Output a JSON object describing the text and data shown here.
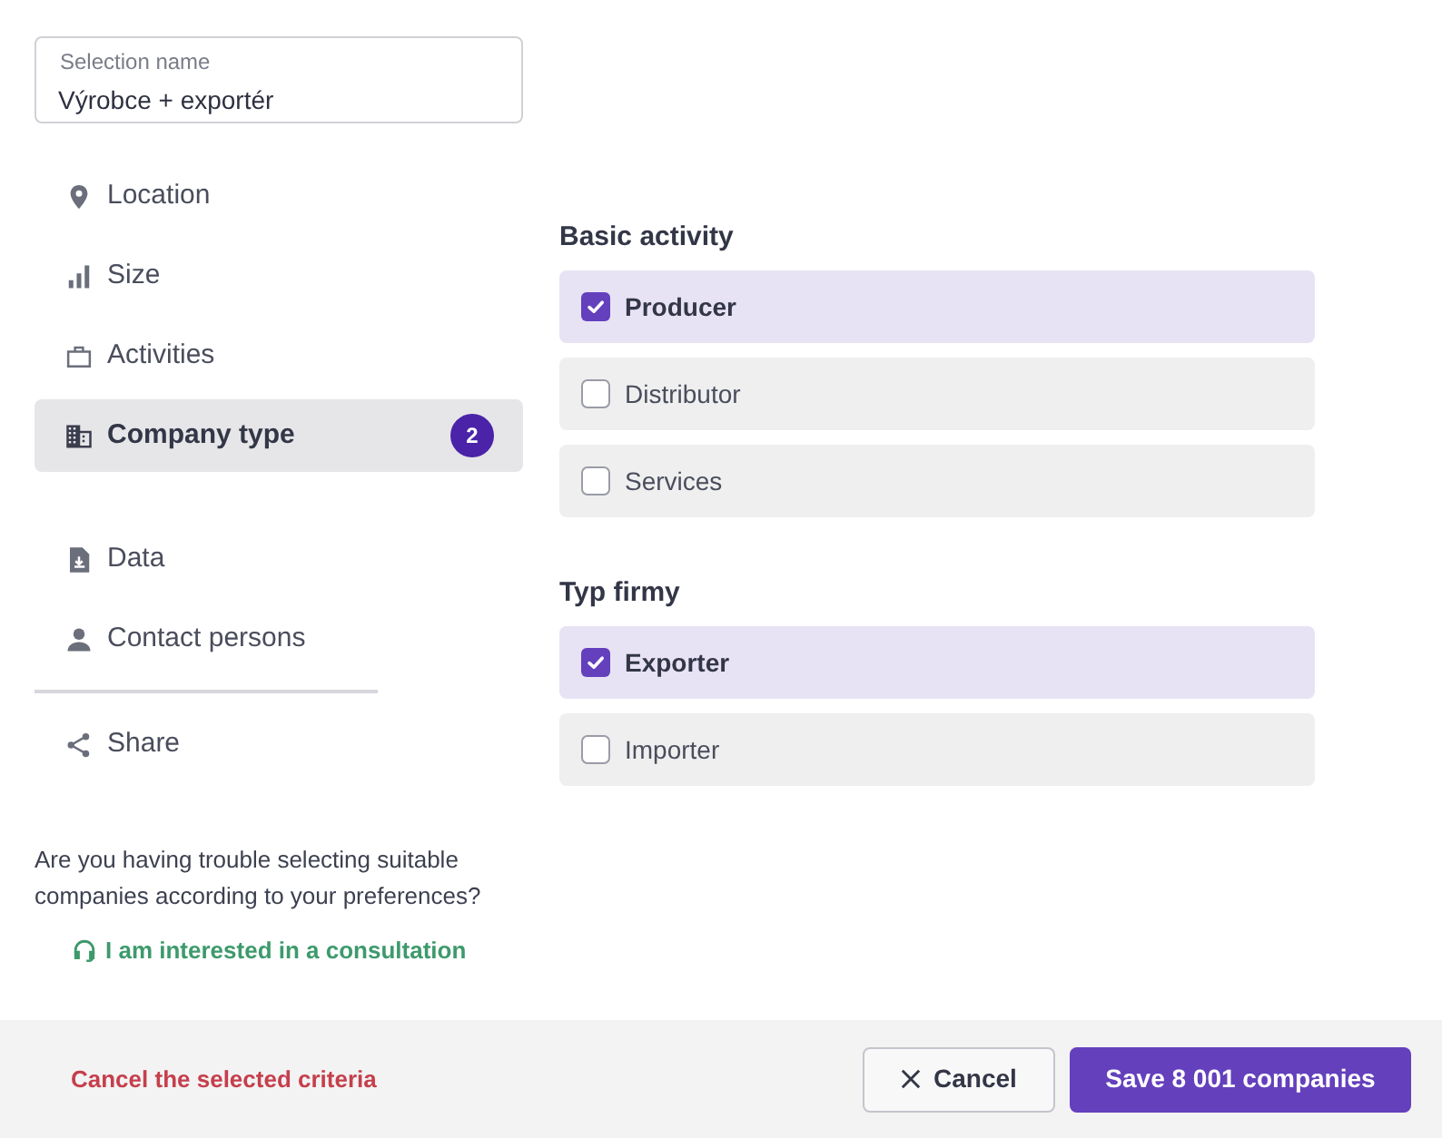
{
  "selection_name": {
    "label": "Selection name",
    "value": "Výrobce + exportér"
  },
  "sidebar": {
    "groups": [
      {
        "divider_after": false,
        "items": [
          {
            "label": "Location",
            "selected": false
          },
          {
            "label": "Size",
            "selected": false
          },
          {
            "label": "Activities",
            "selected": false
          },
          {
            "label": "Company type",
            "selected": true,
            "badge": "2"
          }
        ]
      },
      {
        "divider_after": true,
        "items": [
          {
            "label": "Data",
            "selected": false
          },
          {
            "label": "Contact persons",
            "selected": false
          }
        ]
      },
      {
        "divider_after": false,
        "items": [
          {
            "label": "Share",
            "selected": false
          }
        ]
      }
    ]
  },
  "help": {
    "text": "Are you having trouble selecting suitable companies according to your preferences?",
    "link": "I am interested in a consultation"
  },
  "sections": [
    {
      "title": "Basic activity",
      "options": [
        {
          "label": "Producer",
          "checked": true
        },
        {
          "label": "Distributor",
          "checked": false
        },
        {
          "label": "Services",
          "checked": false
        }
      ]
    },
    {
      "title": "Typ firmy",
      "options": [
        {
          "label": "Exporter",
          "checked": true
        },
        {
          "label": "Importer",
          "checked": false
        }
      ]
    }
  ],
  "footer": {
    "clear_link": "Cancel the selected criteria",
    "cancel_button": "Cancel",
    "save_button": "Save 8 001 companies"
  }
}
